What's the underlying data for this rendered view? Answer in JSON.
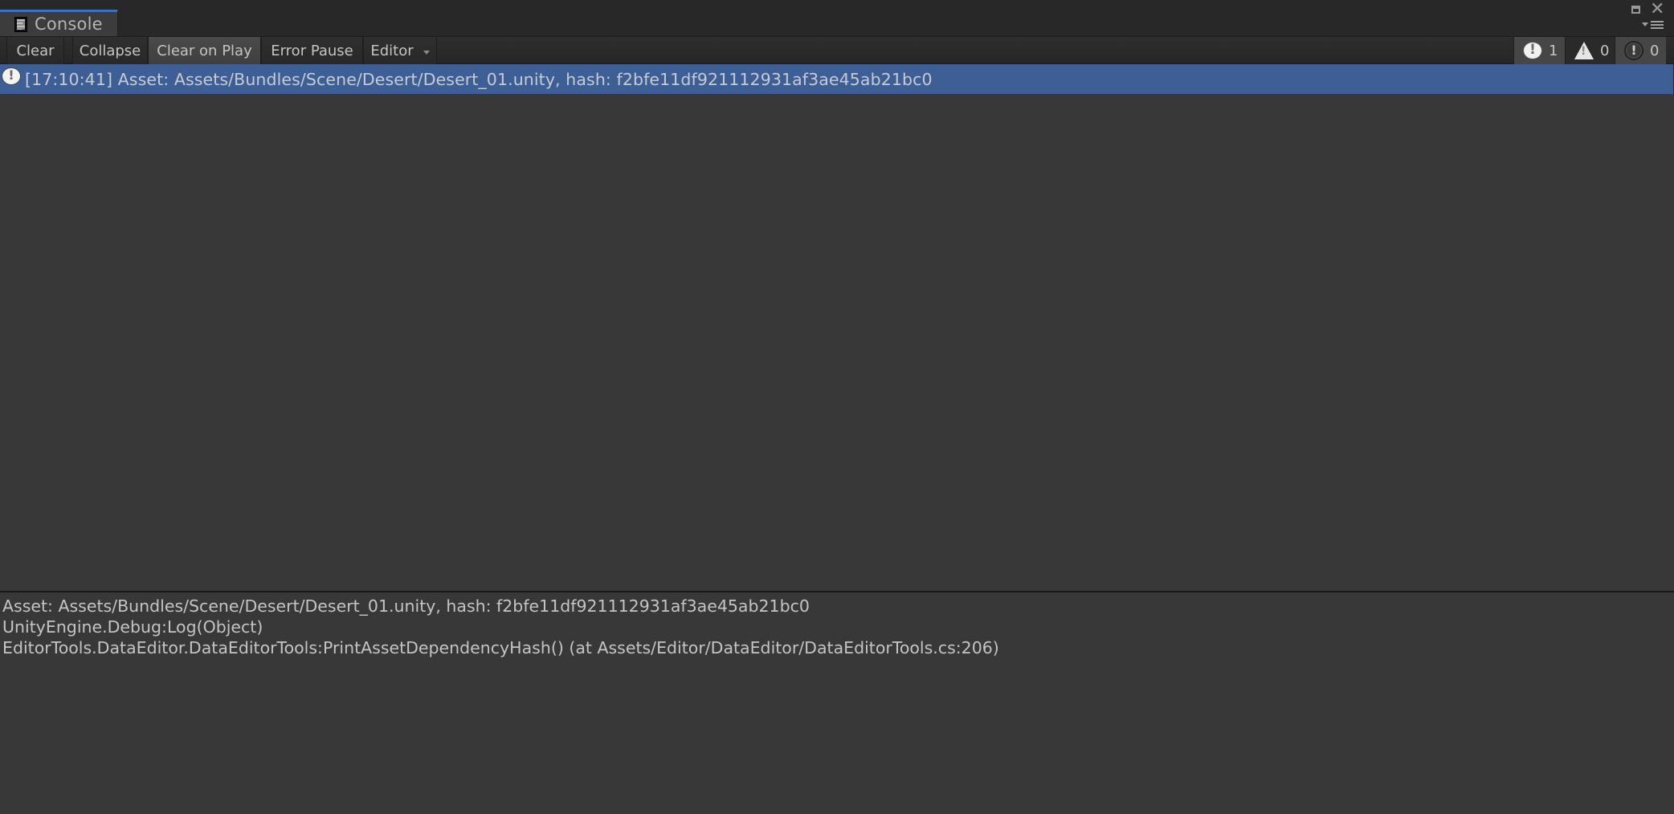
{
  "window": {
    "tab": {
      "title": "Console",
      "icon": "console-icon"
    },
    "controls": {
      "maximize_icon": "maximize-icon",
      "close_icon": "close-icon",
      "menu_icon": "tab-menu-icon"
    }
  },
  "toolbar": {
    "buttons": [
      {
        "label": "Clear",
        "active": false
      },
      {
        "label": "Collapse",
        "active": false
      },
      {
        "label": "Clear on Play",
        "active": true
      },
      {
        "label": "Error Pause",
        "active": false
      },
      {
        "label": "Editor",
        "active": false,
        "dropdown": true
      }
    ],
    "counters": {
      "logs": {
        "icon": "info-icon",
        "count": "1",
        "active": true
      },
      "warnings": {
        "icon": "warning-icon",
        "count": "0",
        "active": false
      },
      "errors": {
        "icon": "error-icon",
        "count": "0",
        "active": true
      }
    }
  },
  "log": {
    "entries": [
      {
        "icon": "info-icon",
        "text": "[17:10:41] Asset: Assets/Bundles/Scene/Desert/Desert_01.unity, hash: f2bfe11df921112931af3ae45ab21bc0",
        "selected": true
      }
    ]
  },
  "details": {
    "lines": [
      "Asset: Assets/Bundles/Scene/Desert/Desert_01.unity, hash: f2bfe11df921112931af3ae45ab21bc0",
      "UnityEngine.Debug:Log(Object)",
      "EditorTools.DataEditor.DataEditorTools:PrintAssetDependencyHash() (at Assets/Editor/DataEditor/DataEditorTools.cs:206)"
    ]
  },
  "colors": {
    "selection": "#3e5f96",
    "tab_accent": "#3a72c0",
    "background": "#383838"
  }
}
